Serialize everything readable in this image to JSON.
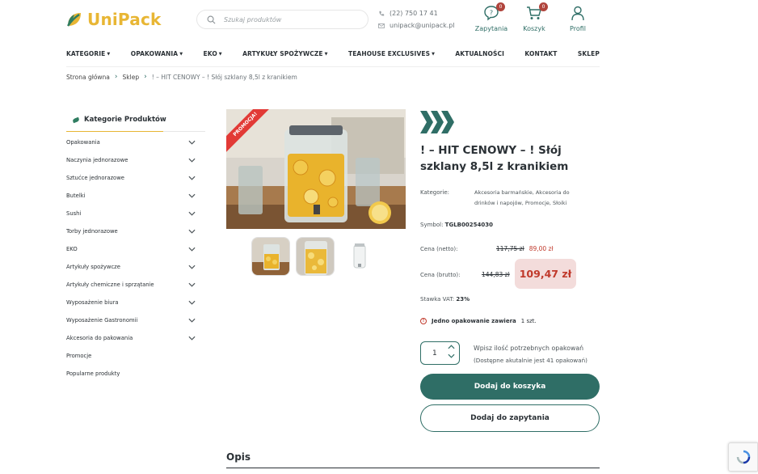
{
  "brand": {
    "name": "UniPack",
    "accent": "#2f6e66",
    "yellow": "#e8b634",
    "sale_red": "#c0392b"
  },
  "header": {
    "search_placeholder": "Szukaj produktów",
    "phone": "(22) 750 17 41",
    "email": "unipack@unipack.pl",
    "icons": [
      {
        "label": "Zapytania",
        "icon": "inquiry-icon",
        "badge": "0"
      },
      {
        "label": "Koszyk",
        "icon": "cart-icon",
        "badge": "0"
      },
      {
        "label": "Profil",
        "icon": "user-icon"
      }
    ]
  },
  "nav": [
    {
      "label": "KATEGORIE",
      "dropdown": true
    },
    {
      "label": "OPAKOWANIA",
      "dropdown": true
    },
    {
      "label": "EKO",
      "dropdown": true
    },
    {
      "label": "ARTYKUŁY SPOŻYWCZE",
      "dropdown": true
    },
    {
      "label": "TEAHOUSE EXCLUSIVES",
      "dropdown": true
    },
    {
      "label": "AKTUALNOŚCI",
      "dropdown": false
    },
    {
      "label": "KONTAKT",
      "dropdown": false
    },
    {
      "label": "SKLEP",
      "dropdown": false
    }
  ],
  "breadcrumb": {
    "home": "Strona główna",
    "shop": "Sklep",
    "current": "! – HIT CENOWY – ! Słój szklany 8,5l z kranikiem"
  },
  "sidebar": {
    "title": "Kategorie Produktów",
    "items": [
      {
        "label": "Opakowania",
        "expandable": true
      },
      {
        "label": "Naczynia jednorazowe",
        "expandable": true
      },
      {
        "label": "Sztućce jednorazowe",
        "expandable": true
      },
      {
        "label": "Butelki",
        "expandable": true
      },
      {
        "label": "Sushi",
        "expandable": true
      },
      {
        "label": "Torby jednorazowe",
        "expandable": true
      },
      {
        "label": "EKO",
        "expandable": true
      },
      {
        "label": "Artykuły spożywcze",
        "expandable": true
      },
      {
        "label": "Artykuły chemiczne i sprzątanie",
        "expandable": true
      },
      {
        "label": "Wyposażenie biura",
        "expandable": true
      },
      {
        "label": "Wyposażenie Gastronomii",
        "expandable": true
      },
      {
        "label": "Akcesoria do pakowania",
        "expandable": true
      },
      {
        "label": "Promocje",
        "expandable": false
      },
      {
        "label": "Popularne produkty",
        "expandable": false
      }
    ]
  },
  "product": {
    "promo_ribbon": "PROMOCJA!",
    "title": "! – HIT CENOWY – ! Słój szklany 8,5l z kranikiem",
    "categories_label": "Kategorie:",
    "categories_value": "Akcesoria barmańskie, Akcesoria do drinków i napojów, Promocje, Słoiki",
    "symbol_label": "Symbol:",
    "symbol_value": "TGLB00254030",
    "net_label": "Cena (netto):",
    "net_old": "117,75 zł",
    "net_new": "89,00 zł",
    "gross_label": "Cena (brutto):",
    "gross_old": "144,83 zł",
    "gross_new": "109,47 zł",
    "vat_label": "Stawka VAT:",
    "vat_value": "23%",
    "package_info": "Jedno opakowanie zawiera",
    "package_unit": "1 szt.",
    "quantity": "1",
    "qty_note_1": "Wpisz ilość potrzebnych opakowań",
    "qty_note_2": "(Dostępne akutalnie jest 41 opakowań)",
    "add_to_cart": "Dodaj do koszyka",
    "add_to_inquiry": "Dodaj do zapytania"
  },
  "description_heading": "Opis"
}
